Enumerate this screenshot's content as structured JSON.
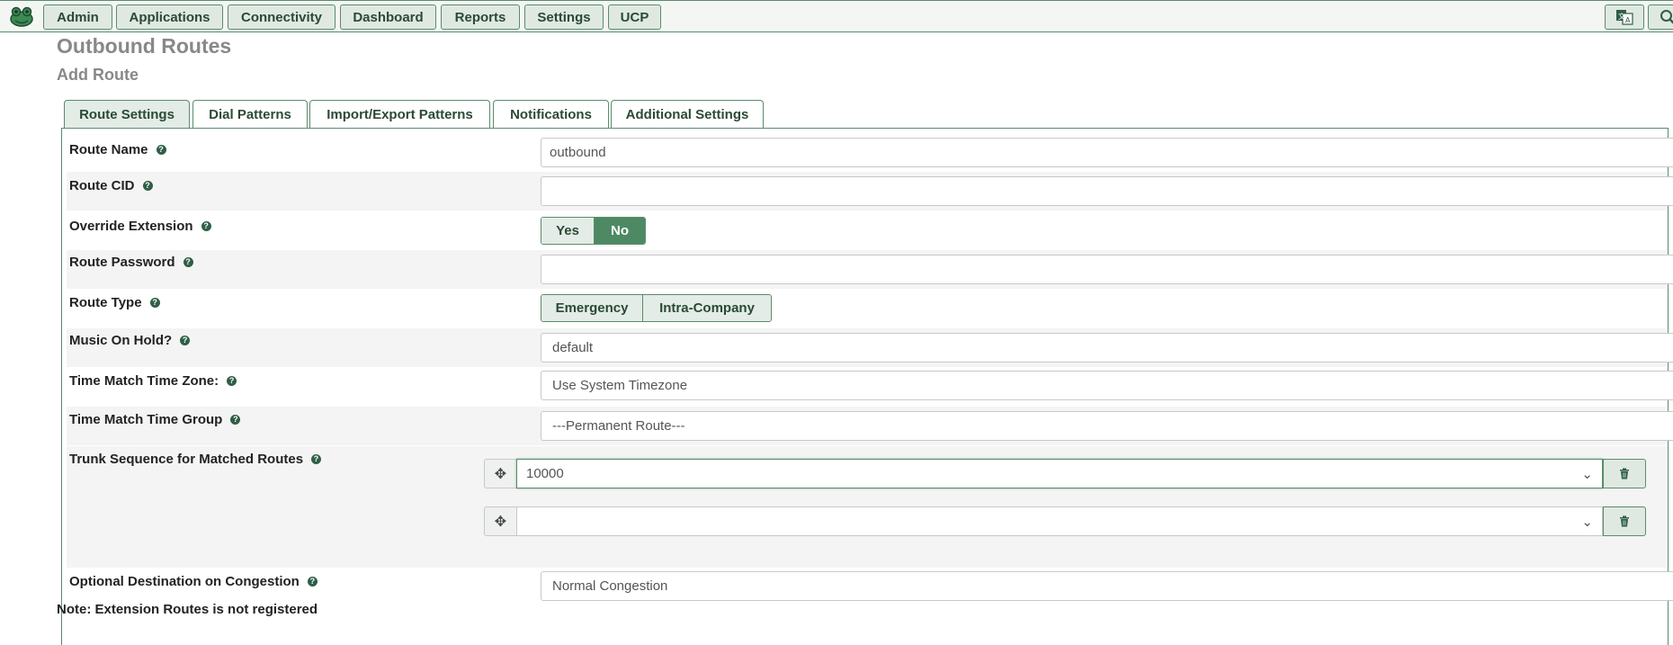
{
  "nav": {
    "items": [
      {
        "label": "Admin",
        "name": "nav-admin"
      },
      {
        "label": "Applications",
        "name": "nav-applications"
      },
      {
        "label": "Connectivity",
        "name": "nav-connectivity"
      },
      {
        "label": "Dashboard",
        "name": "nav-dashboard"
      },
      {
        "label": "Reports",
        "name": "nav-reports"
      },
      {
        "label": "Settings",
        "name": "nav-settings"
      },
      {
        "label": "UCP",
        "name": "nav-ucp"
      }
    ],
    "right_icons": [
      "language-icon",
      "search-icon"
    ]
  },
  "page": {
    "title": "Outbound Routes",
    "subtitle": "Add Route"
  },
  "tabs": [
    {
      "label": "Route Settings",
      "active": true
    },
    {
      "label": "Dial Patterns",
      "active": false
    },
    {
      "label": "Import/Export Patterns",
      "active": false
    },
    {
      "label": "Notifications",
      "active": false
    },
    {
      "label": "Additional Settings",
      "active": false
    }
  ],
  "form": {
    "route_name": {
      "label": "Route Name",
      "value": "outbound"
    },
    "route_cid": {
      "label": "Route CID",
      "value": ""
    },
    "override_extension": {
      "label": "Override Extension",
      "options": [
        "Yes",
        "No"
      ],
      "selected": "No"
    },
    "route_password": {
      "label": "Route Password",
      "value": ""
    },
    "route_type": {
      "label": "Route Type",
      "options": [
        "Emergency",
        "Intra-Company"
      ],
      "selected": ""
    },
    "music_on_hold": {
      "label": "Music On Hold?",
      "value": "default"
    },
    "time_zone": {
      "label": "Time Match Time Zone:",
      "value": "Use System Timezone"
    },
    "time_group": {
      "label": "Time Match Time Group",
      "value": "---Permanent Route---"
    },
    "trunk_sequence": {
      "label": "Trunk Sequence for Matched Routes",
      "trunks": [
        "10000",
        ""
      ]
    },
    "congestion": {
      "label": "Optional Destination on Congestion",
      "value": "Normal Congestion"
    }
  },
  "note": "Note: Extension Routes is not registered",
  "colors": {
    "accent": "#4d8a63",
    "border": "#5b8b6c"
  }
}
